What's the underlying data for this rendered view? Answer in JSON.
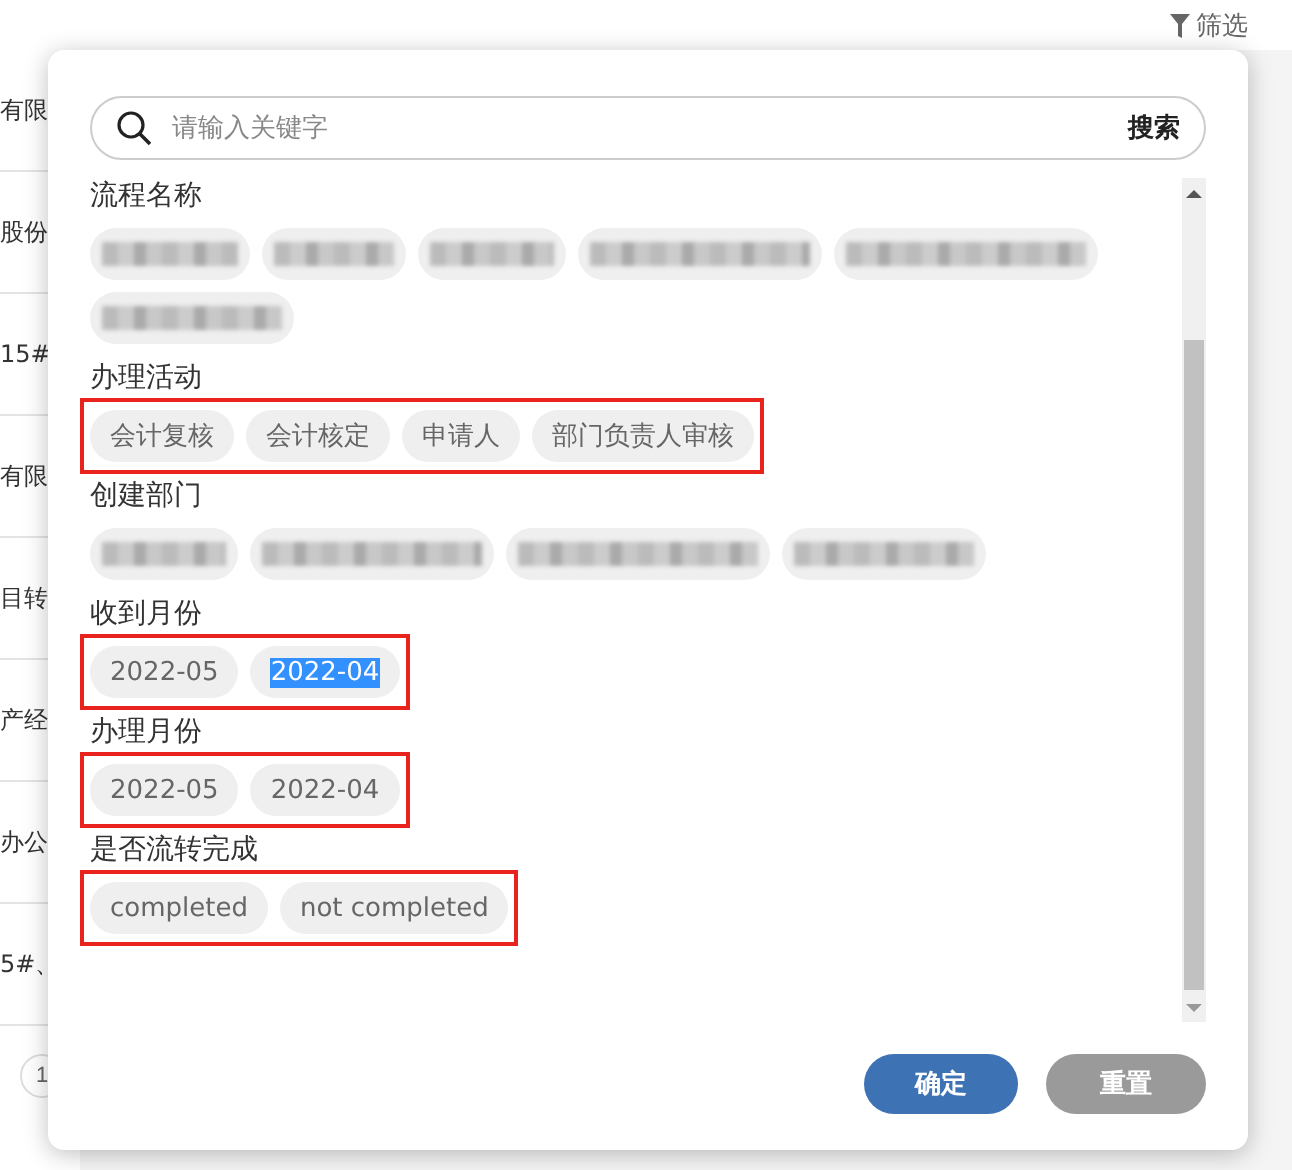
{
  "background": {
    "filter_label": "筛选",
    "rows": [
      "有限",
      "股份",
      "15#",
      "有限",
      "目转",
      "产经",
      "办公",
      "5#、"
    ],
    "page_button": "1"
  },
  "dialog": {
    "search": {
      "placeholder": "请输入关键字",
      "button": "搜索"
    },
    "sections": [
      {
        "title": "流程名称",
        "highlighted": false,
        "chips": [
          {
            "kind": "blurred"
          },
          {
            "kind": "blurred"
          },
          {
            "kind": "blurred"
          },
          {
            "kind": "blurred"
          },
          {
            "kind": "blurred"
          },
          {
            "kind": "blurred"
          }
        ]
      },
      {
        "title": "办理活动",
        "highlighted": true,
        "chips": [
          {
            "kind": "text",
            "label": "会计复核",
            "text_selected": false
          },
          {
            "kind": "text",
            "label": "会计核定",
            "text_selected": false
          },
          {
            "kind": "text",
            "label": "申请人",
            "text_selected": false
          },
          {
            "kind": "text",
            "label": "部门负责人审核",
            "text_selected": false
          }
        ]
      },
      {
        "title": "创建部门",
        "highlighted": false,
        "chips": [
          {
            "kind": "blurred"
          },
          {
            "kind": "blurred"
          },
          {
            "kind": "blurred"
          },
          {
            "kind": "blurred"
          }
        ]
      },
      {
        "title": "收到月份",
        "highlighted": true,
        "chips": [
          {
            "kind": "text",
            "label": "2022-05",
            "text_selected": false
          },
          {
            "kind": "text",
            "label": "2022-04",
            "text_selected": true
          }
        ]
      },
      {
        "title": "办理月份",
        "highlighted": true,
        "chips": [
          {
            "kind": "text",
            "label": "2022-05",
            "text_selected": false
          },
          {
            "kind": "text",
            "label": "2022-04",
            "text_selected": false
          }
        ]
      },
      {
        "title": "是否流转完成",
        "highlighted": true,
        "chips": [
          {
            "kind": "text",
            "label": "completed",
            "text_selected": false
          },
          {
            "kind": "text",
            "label": "not completed",
            "text_selected": false
          }
        ]
      }
    ],
    "buttons": {
      "confirm": "确定",
      "reset": "重置"
    }
  }
}
